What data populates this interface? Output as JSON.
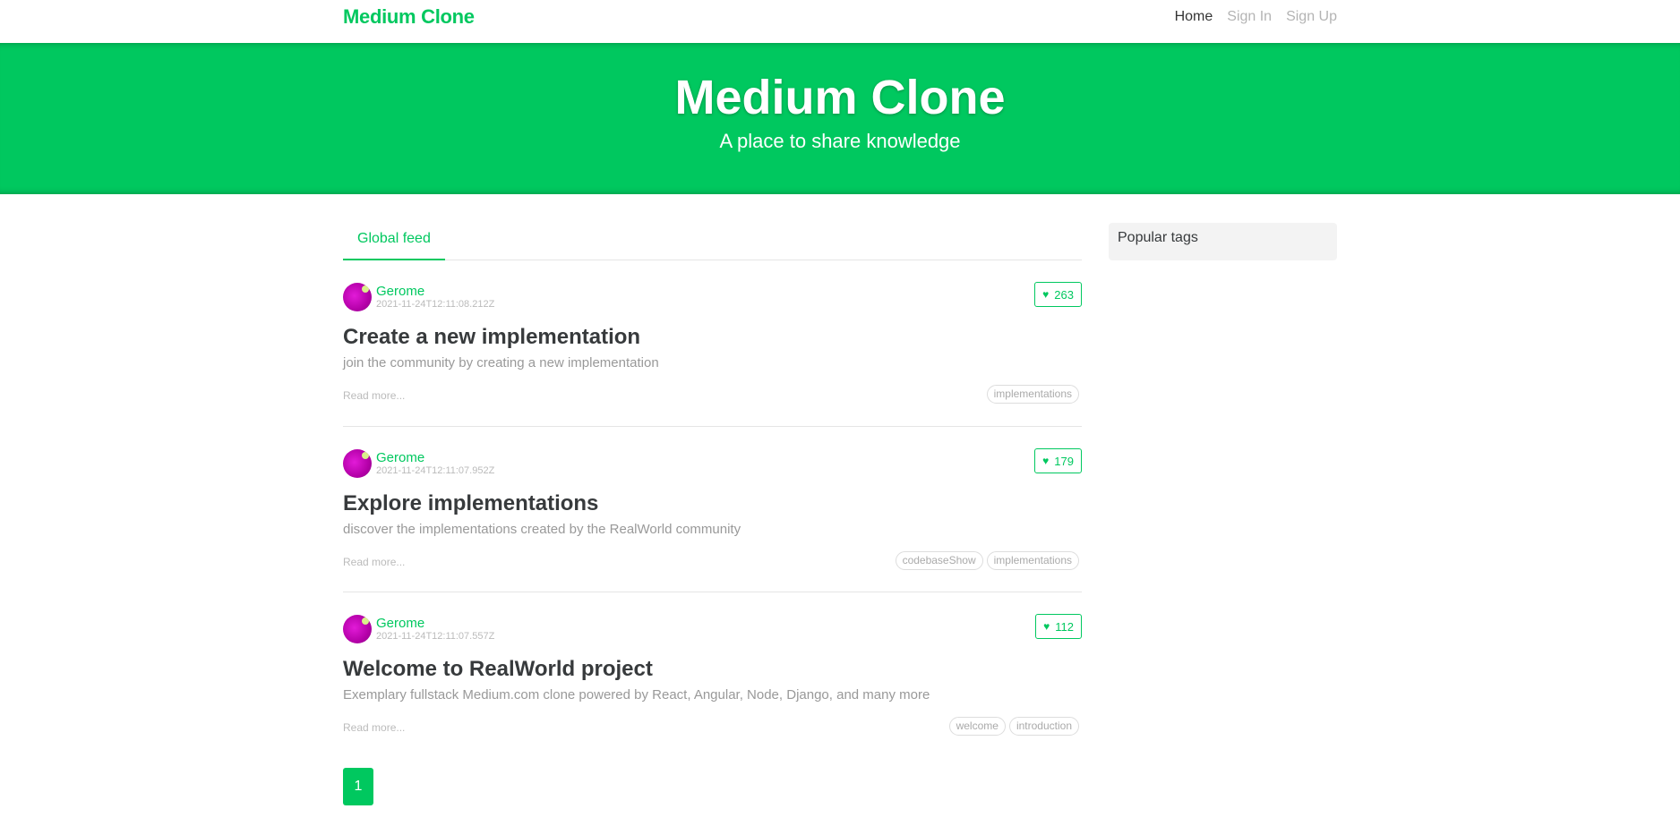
{
  "navbar": {
    "brand": "Medium Clone",
    "links": [
      {
        "label": "Home",
        "active": true
      },
      {
        "label": "Sign In",
        "active": false
      },
      {
        "label": "Sign Up",
        "active": false
      }
    ]
  },
  "banner": {
    "title": "Medium Clone",
    "subtitle": "A place to share knowledge"
  },
  "feed": {
    "tab_label": "Global feed",
    "articles": [
      {
        "author": "Gerome",
        "date": "2021-11-24T12:11:08.212Z",
        "favorites": "263",
        "title": "Create a new implementation",
        "description": "join the community by creating a new implementation",
        "read_more": "Read more...",
        "tags": [
          "implementations"
        ]
      },
      {
        "author": "Gerome",
        "date": "2021-11-24T12:11:07.952Z",
        "favorites": "179",
        "title": "Explore implementations",
        "description": "discover the implementations created by the RealWorld community",
        "read_more": "Read more...",
        "tags": [
          "codebaseShow",
          "implementations"
        ]
      },
      {
        "author": "Gerome",
        "date": "2021-11-24T12:11:07.557Z",
        "favorites": "112",
        "title": "Welcome to RealWorld project",
        "description": "Exemplary fullstack Medium.com clone powered by React, Angular, Node, Django, and many more",
        "read_more": "Read more...",
        "tags": [
          "welcome",
          "introduction"
        ]
      }
    ],
    "pagination": [
      "1"
    ]
  },
  "sidebar": {
    "heading": "Popular tags"
  },
  "colors": {
    "accent": "#00c85f"
  },
  "icons": {
    "favorite": "heart-icon"
  }
}
